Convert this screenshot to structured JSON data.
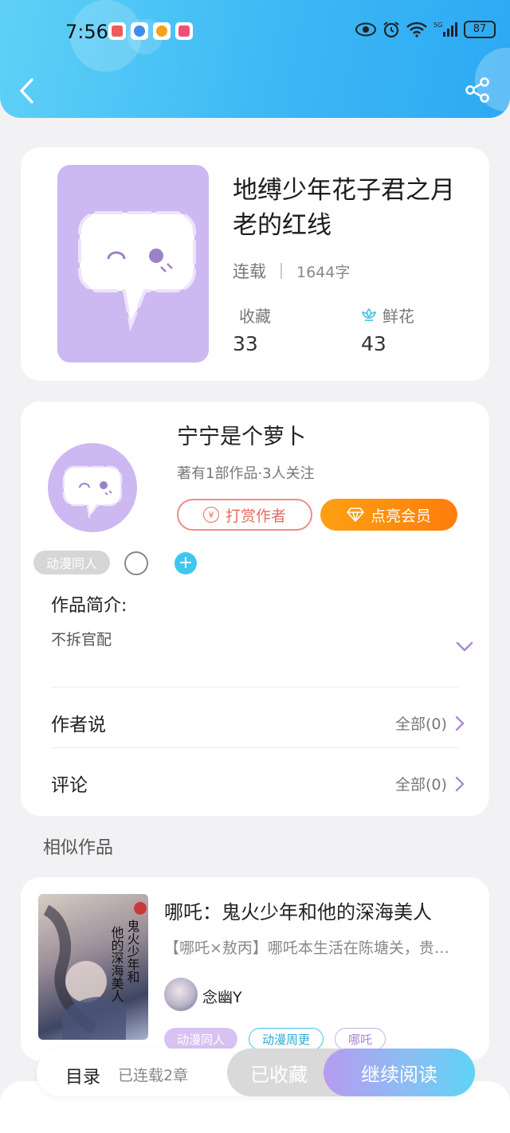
{
  "status_bar": {
    "time": "7:56",
    "network": "5G",
    "battery": "87",
    "apps": [
      "red-app-icon",
      "blue-app-icon",
      "orange-app-icon",
      "pink-app-icon"
    ]
  },
  "header": {
    "back_icon": "chevron-left-icon",
    "share_icon": "share-icon",
    "gradient": [
      "#5fd1f6",
      "#2da9f3"
    ]
  },
  "book": {
    "title": "地缚少年花子君之月老的红线",
    "status": "连载",
    "word_count": "1644字",
    "favorites_label": "收藏",
    "favorites_count": "33",
    "flowers_label": "鲜花",
    "flowers_count": "43"
  },
  "author": {
    "name": "宁宁是个萝卜",
    "meta": "著有1部作品·3人关注",
    "tip_label": "打赏作者",
    "vip_label": "点亮会员",
    "genre_tag": "动漫同人",
    "intro_label": "作品简介:",
    "intro_text": "不拆官配",
    "author_says_label": "作者说",
    "author_says_count": "全部(0)",
    "comments_label": "评论",
    "comments_count": "全部(0)"
  },
  "similar": {
    "section_title": "相似作品",
    "items": [
      {
        "title": "哪吒：鬼火少年和他的深海美人",
        "description": "【哪吒×敖丙】哪吒本生活在陈塘关，贵…",
        "author": "念幽Y",
        "cover_text": "他的深海美人 鬼火少年和",
        "tags": [
          "动漫同人",
          "动漫周更",
          "哪吒"
        ]
      }
    ]
  },
  "bottom_bar": {
    "toc_label": "目录",
    "toc_info": "已连载2章",
    "favorited_label": "已收藏",
    "continue_label": "继续阅读"
  },
  "colors": {
    "accent_purple": "#cdb8f2",
    "accent_cyan": "#3ec7ef",
    "vip_orange": "#ff7d0c",
    "tip_red": "#e86b63"
  }
}
